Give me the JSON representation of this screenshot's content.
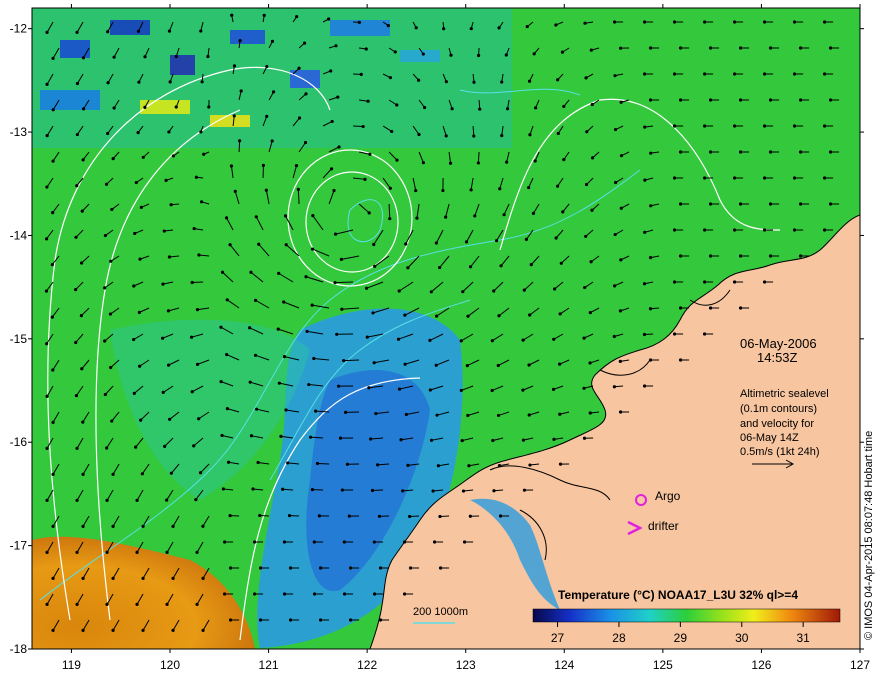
{
  "map": {
    "lon_ticks": [
      "119",
      "120",
      "121",
      "122",
      "123",
      "124",
      "125",
      "126",
      "127"
    ],
    "lat_ticks": [
      "-12",
      "-13",
      "-14",
      "-15",
      "-16",
      "-17",
      "-18"
    ],
    "lon_range": [
      118.6,
      127
    ],
    "lat_range": [
      -18,
      -11.8
    ]
  },
  "annotations": {
    "date": "06-May-2006",
    "time": "14:53Z",
    "altimetry_lines": [
      "Altimetric sealevel",
      "(0.1m contours)",
      "and velocity for",
      "06-May 14Z",
      "0.5m/s (1kt 24h)"
    ],
    "argo_label": "Argo",
    "drifter_label": "drifter",
    "bathymetry_label": "200  1000m"
  },
  "colorbar": {
    "title": "Temperature (°C) NOAA17_L3U 32% ql>=4",
    "ticks": [
      "27",
      "28",
      "29",
      "30",
      "31"
    ],
    "range": [
      26.6,
      31.6
    ]
  },
  "credit": "© IMOS 04-Apr-2015 08:07:48 Hobart time",
  "colors": {
    "land": "#f7c59f",
    "sea_mid": "#2fcf3a",
    "sea_cool": "#2a9be0",
    "contour": "#ffffff",
    "bathy": "#58e0e6",
    "arrow": "#000000",
    "argo": "#e020e0"
  }
}
